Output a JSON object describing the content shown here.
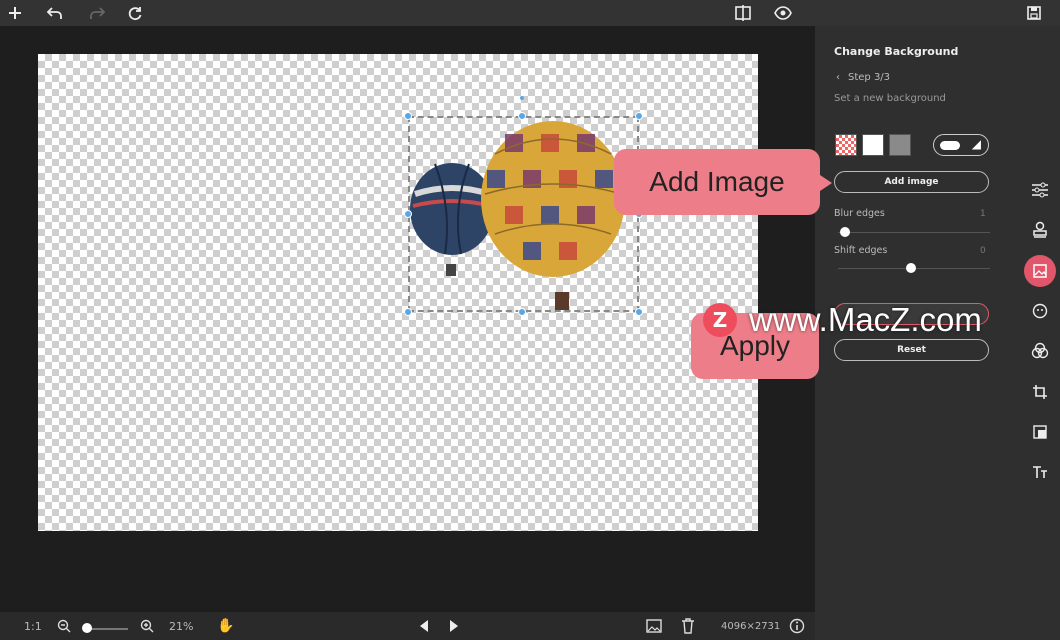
{
  "topbar": {
    "icons": [
      "add-icon",
      "undo-icon",
      "redo-icon",
      "refresh-icon",
      "compare-icon",
      "eye-icon",
      "save-icon"
    ]
  },
  "panel": {
    "title": "Change Background",
    "step": "Step 3/3",
    "subtitle": "Set a new background",
    "add_image_label": "Add image",
    "blur_label": "Blur edges",
    "blur_value": "1",
    "shift_label": "Shift edges",
    "shift_value": "0",
    "apply_label": "Apply",
    "reset_label": "Reset"
  },
  "callouts": {
    "add_image": "Add Image",
    "apply": "Apply"
  },
  "watermark": {
    "logo": "Z",
    "text": "www.MacZ.com"
  },
  "bottombar": {
    "ratio": "1:1",
    "zoom": "21%",
    "dimensions": "4096×2731"
  },
  "colors": {
    "accent": "#e0566a",
    "callout": "#ed7d88",
    "selection_handle": "#5aa7e6"
  }
}
